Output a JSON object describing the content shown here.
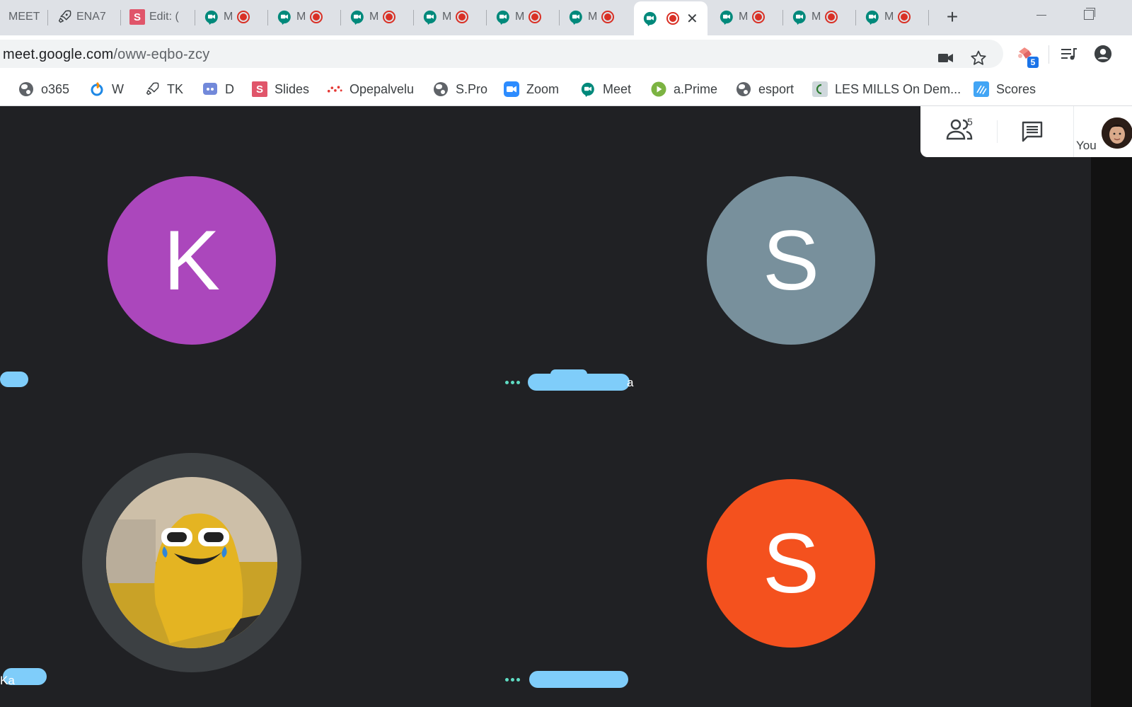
{
  "tabs": [
    {
      "title": "MEET",
      "type": "text"
    },
    {
      "title": "ENA7",
      "type": "rocket"
    },
    {
      "title": "Edit: (",
      "type": "slides"
    },
    {
      "title": "M",
      "type": "meet"
    },
    {
      "title": "M",
      "type": "meet"
    },
    {
      "title": "M",
      "type": "meet"
    },
    {
      "title": "M",
      "type": "meet"
    },
    {
      "title": "M",
      "type": "meet"
    },
    {
      "title": "M",
      "type": "meet"
    },
    {
      "title": "",
      "type": "meet-active"
    },
    {
      "title": "M",
      "type": "meet"
    },
    {
      "title": "M",
      "type": "meet"
    },
    {
      "title": "M",
      "type": "meet"
    }
  ],
  "new_tab_label": "+",
  "address_bar": {
    "domain": "meet.google.com",
    "path": "/oww-eqbo-zcy"
  },
  "extension_badge": "5",
  "bookmarks": [
    {
      "label": "o365",
      "icon": "globe-icon"
    },
    {
      "label": "W",
      "icon": "w-icon"
    },
    {
      "label": "TK",
      "icon": "rocket-icon"
    },
    {
      "label": "D",
      "icon": "discord-icon"
    },
    {
      "label": "Slides",
      "icon": "slides-icon"
    },
    {
      "label": "Opepalvelu",
      "icon": "opepalvelu-icon"
    },
    {
      "label": "S.Pro",
      "icon": "globe-icon"
    },
    {
      "label": "Zoom",
      "icon": "zoom-icon"
    },
    {
      "label": "Meet",
      "icon": "meet-icon"
    },
    {
      "label": "a.Prime",
      "icon": "play-icon"
    },
    {
      "label": "esport",
      "icon": "globe-icon"
    },
    {
      "label": "LES MILLS On Dem...",
      "icon": "lesmills-icon"
    },
    {
      "label": "Scores",
      "icon": "scores-icon"
    }
  ],
  "participants": [
    {
      "initial": "K",
      "color": "#ab47bc",
      "label_suffix": ""
    },
    {
      "initial": "S",
      "color": "#78909c",
      "label_suffix": "a"
    },
    {
      "initial": "",
      "color": "",
      "label_suffix": ""
    },
    {
      "initial": "S",
      "color": "#f4511e",
      "label_suffix": ""
    }
  ],
  "partial_labels": {
    "bottom_left": "Ka"
  },
  "panel": {
    "people_count": "5",
    "you_label": "You"
  },
  "colors": {
    "meet_bg": "#202124",
    "accent_blue": "#1a73e8",
    "record_red": "#d93025"
  }
}
